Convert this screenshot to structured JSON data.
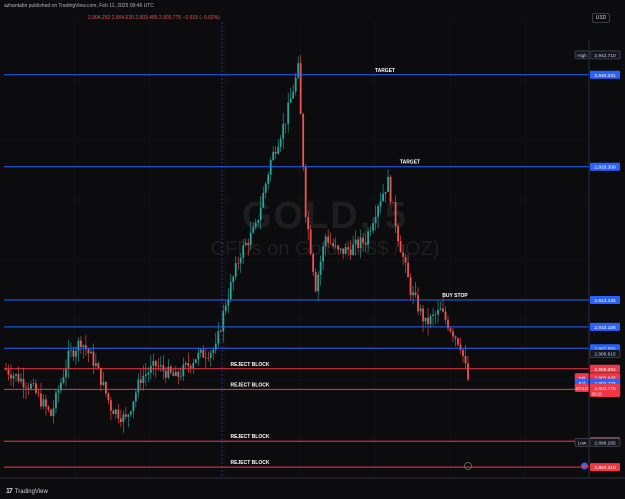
{
  "header": {
    "publisher": "azhantabir published on TradingView.com, Feb 11, 2025 09:46 UTC",
    "ohlc": "2,904.250   2,904.620   2,903.485   2,903.775   −0.515 (−0.02%)",
    "currency": "USD"
  },
  "watermark": {
    "symbol": "GOLD, 5",
    "description": "CFDs on Gold (US$ / OZ)"
  },
  "footer": {
    "logo": "TradingView"
  },
  "colors": {
    "blue_level": "#2962ff",
    "red_level": "#f23645",
    "up_candle": "#26a69a",
    "down_candle": "#ef5350",
    "background": "#0c0c0e"
  },
  "chart_data": {
    "type": "candlestick",
    "y_range": [
      2892.0,
      2944.5
    ],
    "levels": [
      {
        "price": 2940.331,
        "label": "2,940.331",
        "color": "blue",
        "annotation": "TARGET"
      },
      {
        "price": 2929.309,
        "label": "2,929.309",
        "color": "blue",
        "annotation": "TARGET"
      },
      {
        "price": 2913.335,
        "label": "2,913.335",
        "color": "blue",
        "annotation": "BUY STOP"
      },
      {
        "price": 2910.108,
        "label": "2,910.108",
        "color": "blue",
        "annotation": ""
      },
      {
        "price": 2907.55,
        "label": "2,907.550",
        "color": "blue",
        "annotation": ""
      },
      {
        "price": 2905.094,
        "label": "2,905.094",
        "color": "red",
        "annotation": "REJECT BLOCK"
      },
      {
        "price": 2902.617,
        "label": "2,902.617",
        "color": "red",
        "annotation": "REJECT BLOCK"
      },
      {
        "price": 2896.41,
        "label": "2,896.410",
        "color": "red",
        "annotation": "REJECT BLOCK"
      },
      {
        "price": 2893.31,
        "label": "2,893.310",
        "color": "red",
        "annotation": "REJECT BLOCK"
      }
    ],
    "price_badges": [
      {
        "price": 2942.71,
        "label": "2,942.710",
        "tag": "High"
      },
      {
        "price": 2906.915,
        "label": "2,906.915",
        "tag": ""
      },
      {
        "price": 2903.946,
        "label": "2,903.946",
        "tag": "Ask"
      },
      {
        "price": 2903.776,
        "label": "2,903.776",
        "tag": "Bid"
      },
      {
        "price": 2903.775,
        "label": "2,903.775",
        "tag": "GOLD",
        "sub": "00:21"
      },
      {
        "price": 2896.265,
        "label": "2,896.265",
        "tag": "Low"
      }
    ],
    "anchors": [
      {
        "i": 0,
        "p": 2905.0
      },
      {
        "i": 10,
        "p": 2903.0
      },
      {
        "i": 18,
        "p": 2899.5
      },
      {
        "i": 25,
        "p": 2906.5
      },
      {
        "i": 30,
        "p": 2908.5
      },
      {
        "i": 36,
        "p": 2905.5
      },
      {
        "i": 42,
        "p": 2900.5
      },
      {
        "i": 48,
        "p": 2899.0
      },
      {
        "i": 54,
        "p": 2904.0
      },
      {
        "i": 60,
        "p": 2905.5
      },
      {
        "i": 68,
        "p": 2904.0
      },
      {
        "i": 76,
        "p": 2906.5
      },
      {
        "i": 84,
        "p": 2907.5
      },
      {
        "i": 88,
        "p": 2913.0
      },
      {
        "i": 94,
        "p": 2919.0
      },
      {
        "i": 100,
        "p": 2922.0
      },
      {
        "i": 106,
        "p": 2930.0
      },
      {
        "i": 112,
        "p": 2935.0
      },
      {
        "i": 117,
        "p": 2941.0
      },
      {
        "i": 120,
        "p": 2924.0
      },
      {
        "i": 124,
        "p": 2915.0
      },
      {
        "i": 128,
        "p": 2921.0
      },
      {
        "i": 133,
        "p": 2919.0
      },
      {
        "i": 138,
        "p": 2919.5
      },
      {
        "i": 144,
        "p": 2920.5
      },
      {
        "i": 149,
        "p": 2925.0
      },
      {
        "i": 153,
        "p": 2927.5
      },
      {
        "i": 157,
        "p": 2921.0
      },
      {
        "i": 162,
        "p": 2914.5
      },
      {
        "i": 168,
        "p": 2910.5
      },
      {
        "i": 174,
        "p": 2912.0
      },
      {
        "i": 178,
        "p": 2910.0
      },
      {
        "i": 182,
        "p": 2908.0
      },
      {
        "i": 185,
        "p": 2903.8
      }
    ]
  }
}
